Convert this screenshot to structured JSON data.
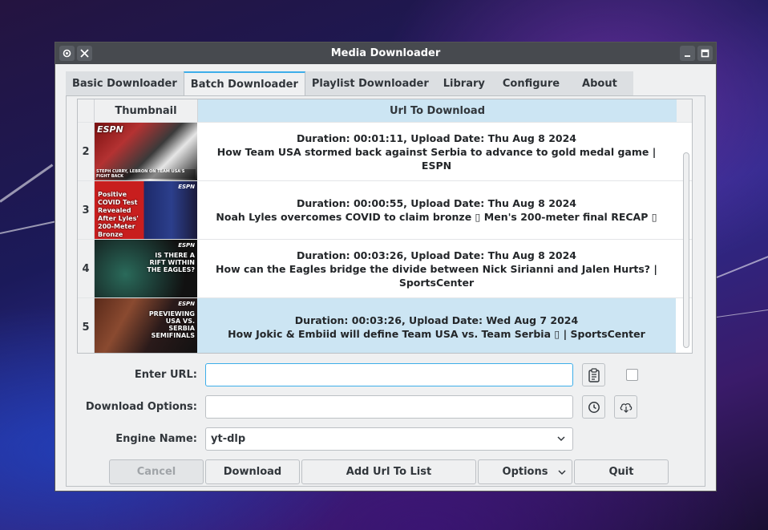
{
  "window": {
    "title": "Media Downloader"
  },
  "tabs": [
    {
      "label": "Basic Downloader",
      "active": false
    },
    {
      "label": "Batch Downloader",
      "active": true
    },
    {
      "label": "Playlist Downloader",
      "active": false
    },
    {
      "label": "Library",
      "active": false
    },
    {
      "label": "Configure",
      "active": false
    },
    {
      "label": "About",
      "active": false
    }
  ],
  "table": {
    "columns": [
      "Thumbnail",
      "Url To Download"
    ],
    "rows": [
      {
        "num": "2",
        "duration_line": "Duration: 00:01:11, Upload Date: Thu Aug 8 2024",
        "title_line": "How Team USA stormed back against Serbia to advance to gold medal game | ESPN",
        "thumb_caption": "STEPH CURRY, LEBRON ON TEAM USA'S FIGHT BACK",
        "thumb_text": "ESPN",
        "selected": false
      },
      {
        "num": "3",
        "duration_line": "Duration: 00:00:55, Upload Date: Thu Aug 8 2024",
        "title_line": "Noah Lyles overcomes COVID to claim bronze ▯ Men's 200-meter final RECAP ▯",
        "thumb_text": "Positive COVID Test Revealed After Lyles' 200-Meter Bronze",
        "selected": false
      },
      {
        "num": "4",
        "duration_line": "Duration: 00:03:26, Upload Date: Thu Aug 8 2024",
        "title_line": "How can the Eagles bridge the divide between Nick Sirianni and Jalen Hurts? | SportsCenter",
        "thumb_text": "IS THERE A RIFT WITHIN THE EAGLES?",
        "selected": false
      },
      {
        "num": "5",
        "duration_line": "Duration: 00:03:26, Upload Date: Wed Aug 7 2024",
        "title_line": "How Jokic & Embiid will define Team USA vs. Team Serbia ▯ | SportsCenter",
        "thumb_text": "PREVIEWING USA VS. SERBIA SEMIFINALS",
        "selected": true
      }
    ],
    "thumb_badge": "ESPN"
  },
  "form": {
    "url_label": "Enter URL:",
    "url_value": "",
    "options_label": "Download Options:",
    "options_value": "",
    "engine_label": "Engine Name:",
    "engine_value": "yt-dlp"
  },
  "buttons": {
    "cancel": "Cancel",
    "download": "Download",
    "add_url": "Add Url To List",
    "options": "Options",
    "quit": "Quit"
  },
  "colors": {
    "accent": "#3daee9",
    "selection": "#cce5f3",
    "titlebar": "#474a4f"
  }
}
